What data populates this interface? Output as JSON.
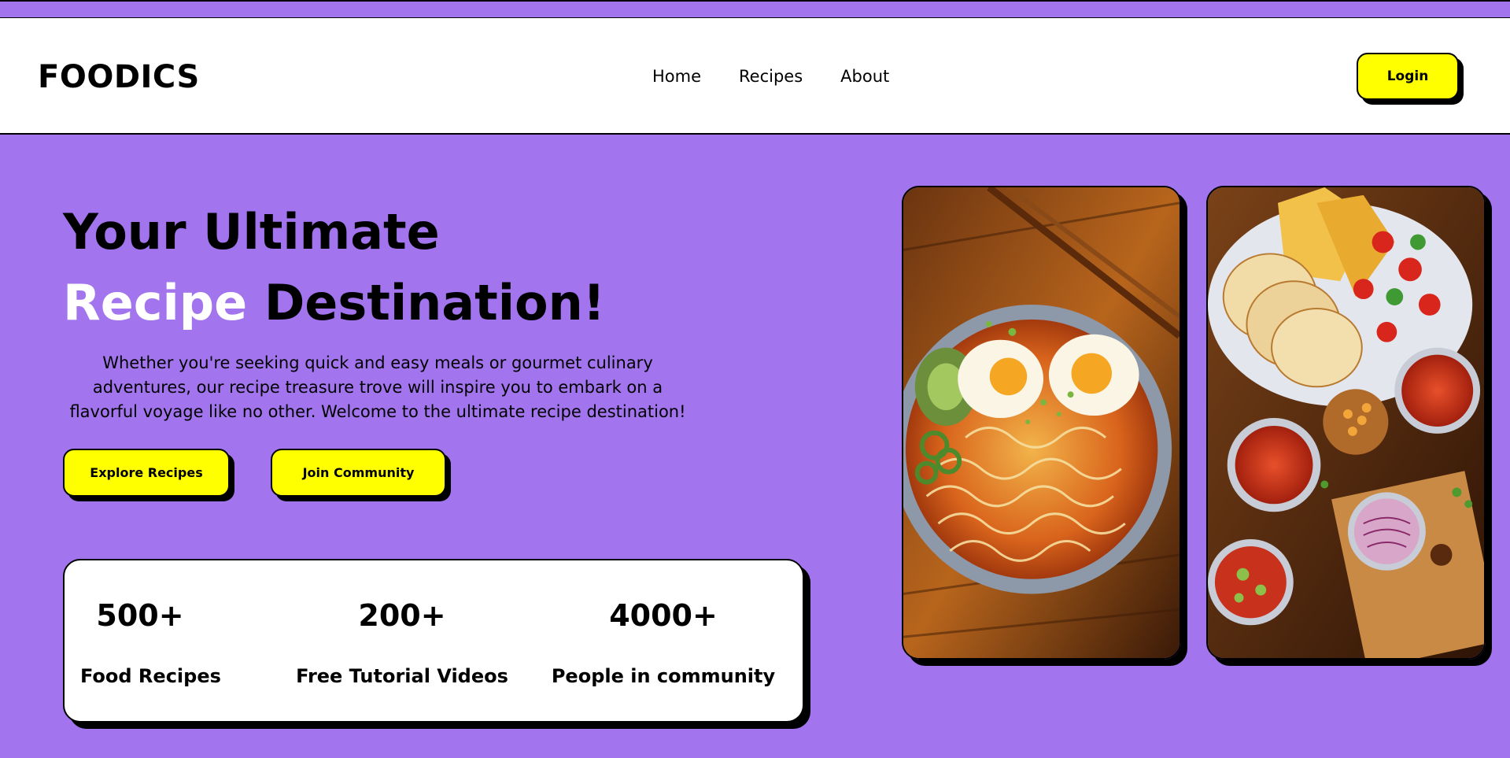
{
  "header": {
    "logo": "FOODICS",
    "nav": [
      "Home",
      "Recipes",
      "About"
    ],
    "login_label": "Login"
  },
  "hero": {
    "title_line1": "Your Ultimate",
    "title_highlight": "Recipe",
    "title_rest": " Destination!",
    "description": "Whether you're seeking quick and easy meals or gourmet culinary adventures, our recipe treasure trove will inspire you to embark on a flavorful voyage like no other. Welcome to the ultimate recipe destination!",
    "explore_label": "Explore Recipes",
    "join_label": "Join Community"
  },
  "stats": [
    {
      "value": "500+",
      "label": "Food Recipes"
    },
    {
      "value": "200+",
      "label": "Free Tutorial Videos"
    },
    {
      "value": "4000+",
      "label": "People in community"
    }
  ],
  "colors": {
    "background": "#a274ee",
    "accent": "#ffff00",
    "highlight_text": "#ffffff"
  }
}
